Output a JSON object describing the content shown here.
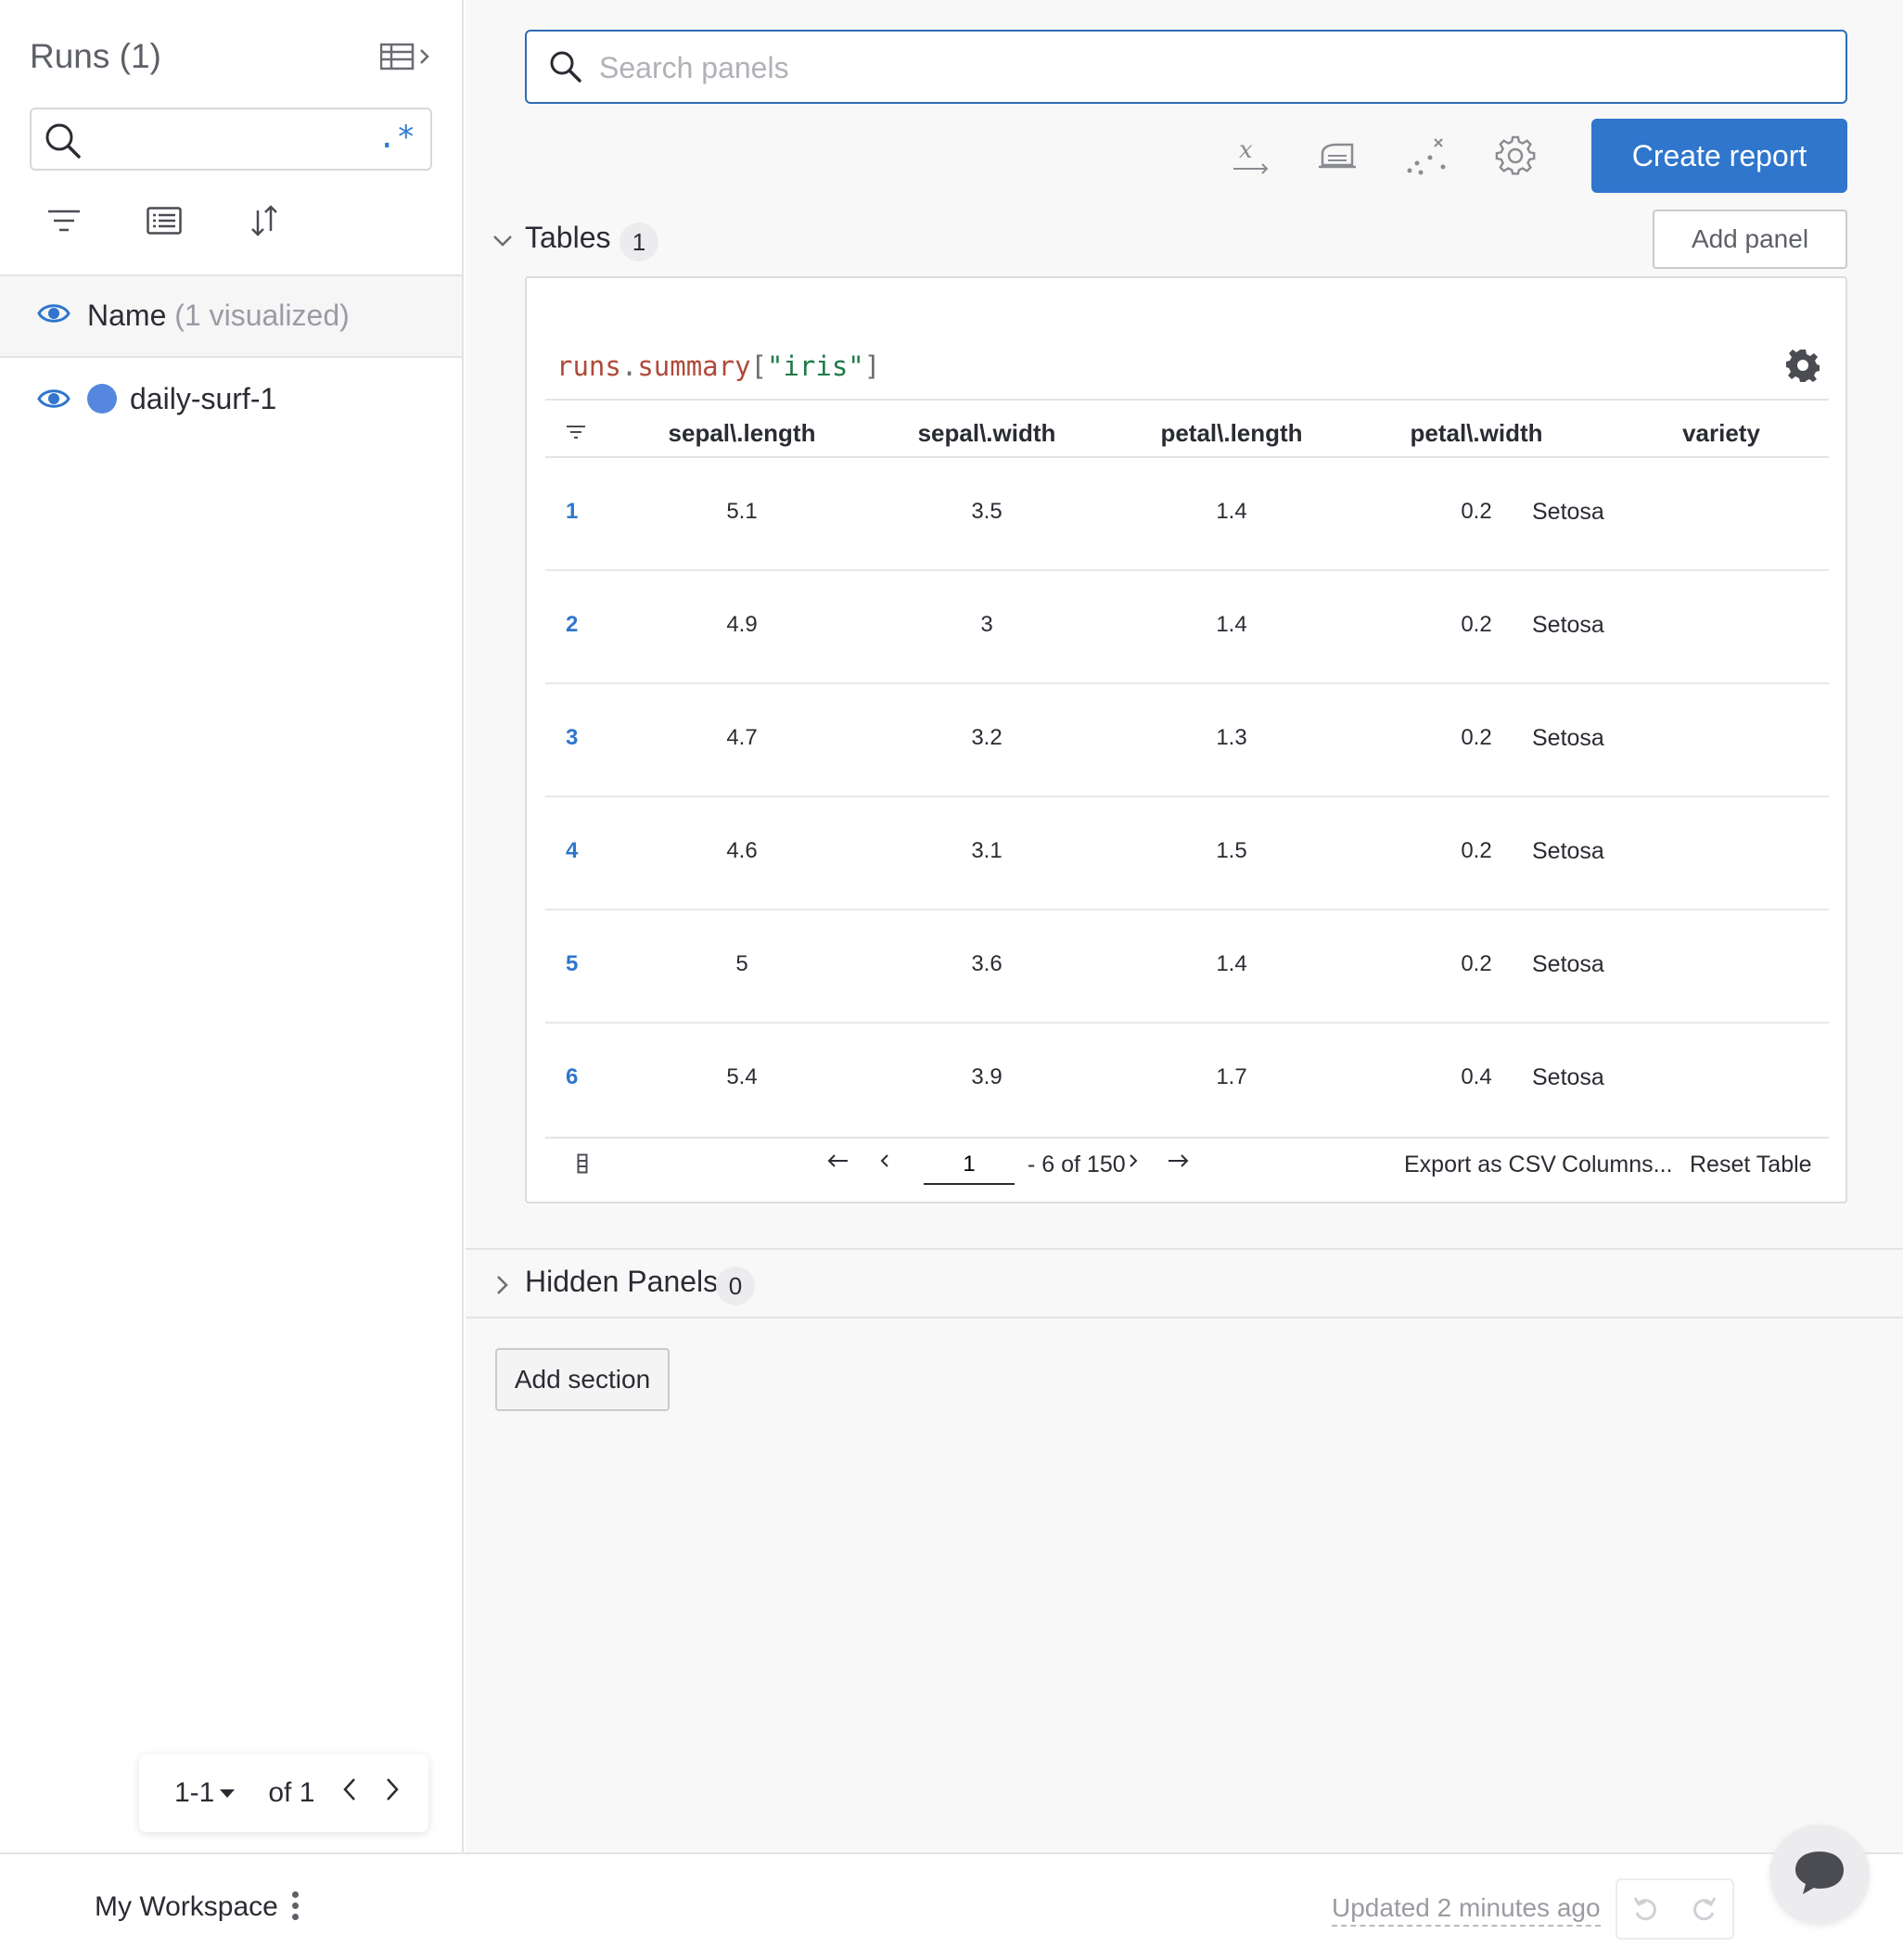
{
  "sidebar": {
    "runs_title": "Runs (1)",
    "regex_label": ".*",
    "name_header": "Name",
    "name_header_note": "(1 visualized)",
    "runs": [
      {
        "name": "daily-surf-1",
        "color": "#5687df"
      }
    ],
    "pager": {
      "range": "1-1",
      "of": "of 1"
    }
  },
  "main": {
    "search_placeholder": "Search panels",
    "create_report": "Create report",
    "add_panel": "Add panel",
    "tables_section": {
      "title": "Tables",
      "count": "1"
    },
    "hidden_section": {
      "title": "Hidden Panels",
      "count": "0"
    },
    "add_section": "Add section",
    "panel": {
      "expression": {
        "obj": "runs",
        "dot": ".",
        "attr": "summary",
        "open": "[",
        "key": "\"iris\"",
        "close": "]"
      },
      "columns": [
        "sepal\\.length",
        "sepal\\.width",
        "petal\\.length",
        "petal\\.width",
        "variety"
      ],
      "rows": [
        {
          "idx": "1",
          "sl": "5.1",
          "sw": "3.5",
          "pl": "1.4",
          "pw": "0.2",
          "variety": "Setosa"
        },
        {
          "idx": "2",
          "sl": "4.9",
          "sw": "3",
          "pl": "1.4",
          "pw": "0.2",
          "variety": "Setosa"
        },
        {
          "idx": "3",
          "sl": "4.7",
          "sw": "3.2",
          "pl": "1.3",
          "pw": "0.2",
          "variety": "Setosa"
        },
        {
          "idx": "4",
          "sl": "4.6",
          "sw": "3.1",
          "pl": "1.5",
          "pw": "0.2",
          "variety": "Setosa"
        },
        {
          "idx": "5",
          "sl": "5",
          "sw": "3.6",
          "pl": "1.4",
          "pw": "0.2",
          "variety": "Setosa"
        },
        {
          "idx": "6",
          "sl": "5.4",
          "sw": "3.9",
          "pl": "1.7",
          "pw": "0.4",
          "variety": "Setosa"
        }
      ],
      "footer": {
        "page_value": "1",
        "range_text": "- 6 of 150",
        "export": "Export as CSV",
        "columns": "Columns...",
        "reset": "Reset Table"
      }
    }
  },
  "bottom": {
    "workspace": "My Workspace",
    "updated": "Updated 2 minutes ago"
  },
  "colors": {
    "accent": "#2f76cc",
    "run": "#5687df",
    "index": "#2f76cc"
  }
}
